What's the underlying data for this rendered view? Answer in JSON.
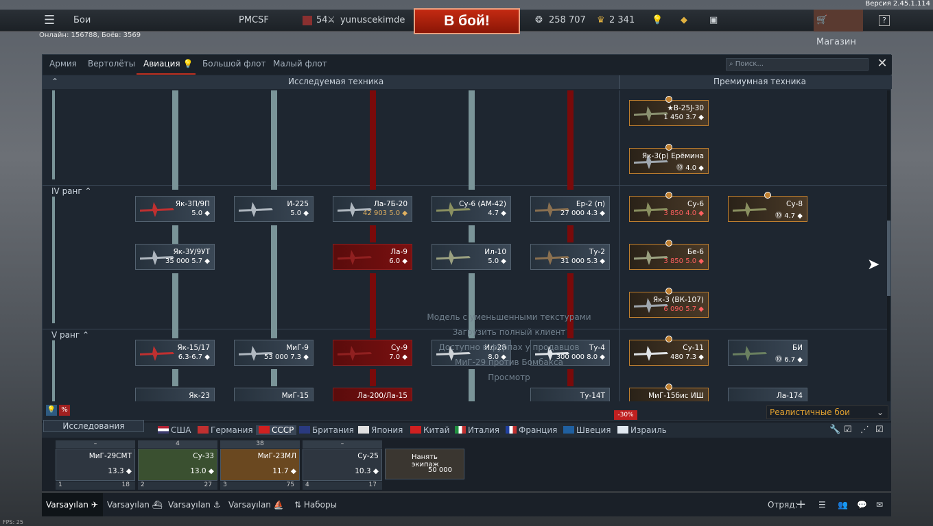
{
  "version": "Версия 2.45.1.114",
  "topbar": {
    "menu_icon": "hamburger-icon",
    "section": "Бои",
    "squad": "PMCSF",
    "level": "54",
    "username": "yunuscekimde",
    "battle_button": "В бой!",
    "silver": "258 707",
    "gold": "2 341",
    "shop": "Магазин",
    "help": "?"
  },
  "online": "Онлайн: 156788, Боёв: 3569",
  "tabs": [
    {
      "label": "Армия"
    },
    {
      "label": "Вертолёты"
    },
    {
      "label": "Авиация"
    },
    {
      "label": "Большой флот"
    },
    {
      "label": "Малый флот"
    }
  ],
  "search": {
    "placeholder": "⌕ Поиск..."
  },
  "headers": {
    "researched": "Исследуемая техника",
    "premium": "Премиумная техника"
  },
  "ranks": {
    "r4": "IV ранг",
    "r5": "V ранг"
  },
  "cards": [
    {
      "name": "Як-3П/9П",
      "stats": "5.0 ◆"
    },
    {
      "name": "И-225",
      "stats": "5.0 ◆"
    },
    {
      "name": "Ла-7Б-20",
      "stats": "42 903 5.0 ◆"
    },
    {
      "name": "Су-6 (АМ-42)",
      "stats": "4.7 ◆"
    },
    {
      "name": "Ер-2 (п)",
      "stats": "27 000 4.3 ◆"
    },
    {
      "name": "Як-3У/9УТ",
      "stats": "35 000 5.7 ◆"
    },
    {
      "name": "Ла-9",
      "stats": "6.0 ◆"
    },
    {
      "name": "Ил-10",
      "stats": "5.0 ◆"
    },
    {
      "name": "Ту-2",
      "stats": "31 000 5.3 ◆"
    },
    {
      "name": "Як-15/17",
      "stats": "6.3-6.7 ◆"
    },
    {
      "name": "МиГ-9",
      "stats": "53 000 7.3 ◆"
    },
    {
      "name": "Су-9",
      "stats": "7.0 ◆"
    },
    {
      "name": "Ил-28",
      "stats": "8.0 ◆"
    },
    {
      "name": "Ту-4",
      "stats": "300 000 8.0 ◆"
    },
    {
      "name": "Як-23",
      "stats": ""
    },
    {
      "name": "МиГ-15",
      "stats": ""
    },
    {
      "name": "Ла-200/Ла-15",
      "stats": ""
    },
    {
      "name": "Ту-14Т",
      "stats": ""
    }
  ],
  "premium_cards": [
    {
      "name": "★B-25J-30",
      "stats": "1 450 3.7 ◆"
    },
    {
      "name": "Як-3(р) Ерёмина",
      "stats": "⓾ 4.0 ◆"
    },
    {
      "name": "Су-6",
      "stats": "3 850 4.0 ◆"
    },
    {
      "name": "Су-8",
      "stats": "⓾ 4.7 ◆"
    },
    {
      "name": "Бе-6",
      "stats": "3 850 5.0 ◆"
    },
    {
      "name": "Як-3 (ВК-107)",
      "stats": "6 090 5.7 ◆"
    },
    {
      "name": "Су-11",
      "stats": "480 7.3 ◆"
    },
    {
      "name": "БИ",
      "stats": "⓾ 6.7 ◆"
    },
    {
      "name": "МиГ-15бис ИШ",
      "stats": ""
    },
    {
      "name": "Ла-174",
      "stats": ""
    }
  ],
  "watermark": [
    "Модель с уменьшенными текстурами",
    "Загрузить полный клиент",
    "Доступно в фурпах у продавцов",
    "МиГ-29 против Бомбакса",
    "Просмотр"
  ],
  "research_tab": "Исследования",
  "discount": "-30%",
  "mode": "Реалистичные бои",
  "nations": [
    {
      "name": "США"
    },
    {
      "name": "Германия"
    },
    {
      "name": "СССР"
    },
    {
      "name": "Британия"
    },
    {
      "name": "Япония"
    },
    {
      "name": "Китай"
    },
    {
      "name": "Италия"
    },
    {
      "name": "Франция"
    },
    {
      "name": "Швеция"
    },
    {
      "name": "Израиль"
    }
  ],
  "crew": [
    {
      "hdr": "–",
      "name": "МиГ-29СМТ",
      "rating": "13.3 ◆",
      "slot": "1",
      "num": "18"
    },
    {
      "hdr": "4",
      "name": "Су-33",
      "rating": "13.0 ◆",
      "slot": "2",
      "num": "27"
    },
    {
      "hdr": "38",
      "name": "МиГ-23МЛ",
      "rating": "11.7 ◆",
      "slot": "3",
      "num": "75"
    },
    {
      "hdr": "–",
      "name": "Су-25",
      "rating": "10.3 ◆",
      "slot": "4",
      "num": "17"
    }
  ],
  "hire": {
    "label": "Нанять экипаж",
    "cost": "50 000"
  },
  "presets": [
    {
      "label": "Varsayılan"
    },
    {
      "label": "Varsayılan"
    },
    {
      "label": "Varsayılan"
    },
    {
      "label": "Varsayılan"
    },
    {
      "label": "Наборы"
    }
  ],
  "squad_label": "Отряд:",
  "fps": "FPS: 25"
}
